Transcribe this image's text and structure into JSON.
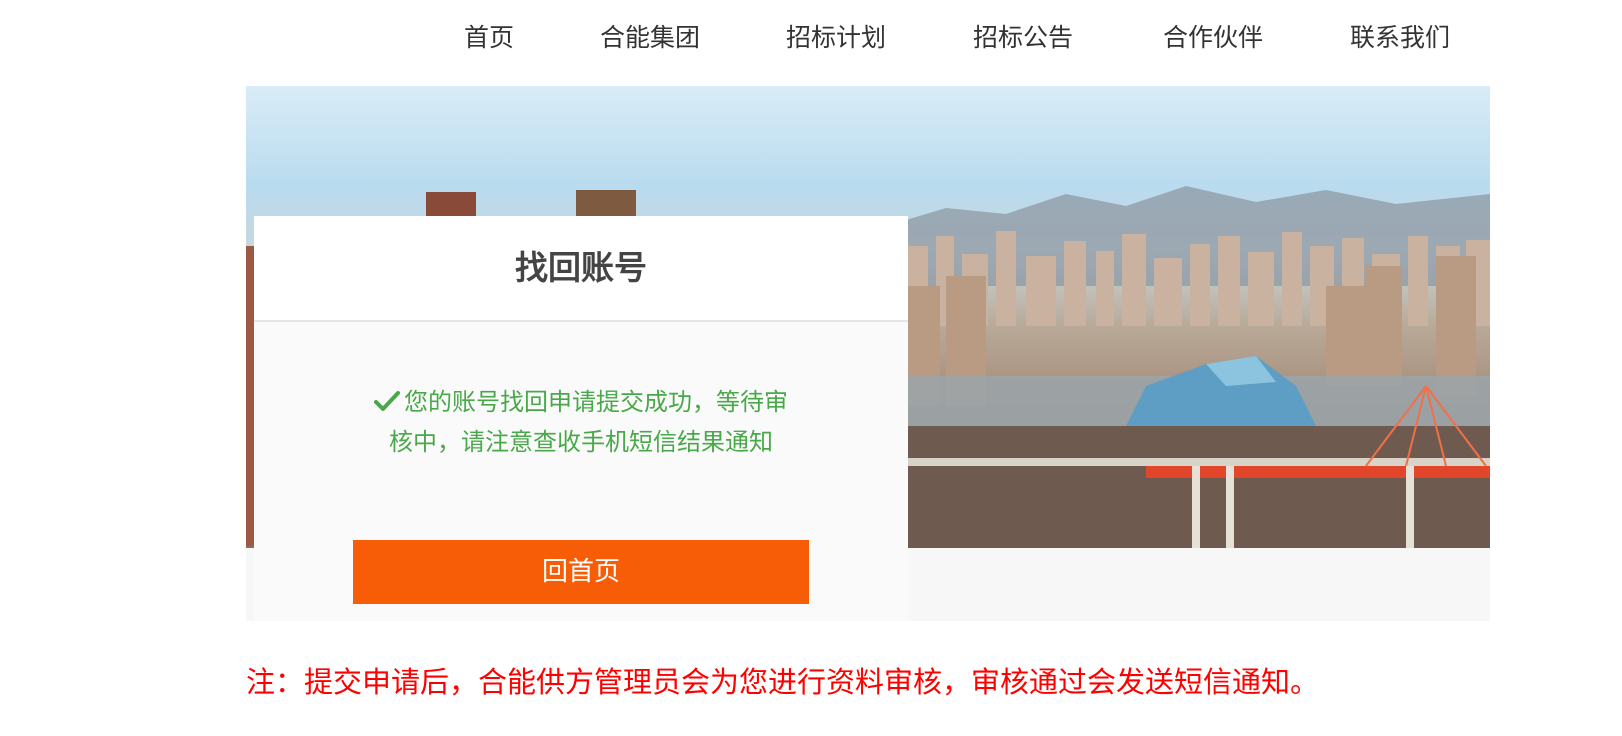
{
  "nav": {
    "items": [
      {
        "label": "首页"
      },
      {
        "label": "合能集团"
      },
      {
        "label": "招标计划"
      },
      {
        "label": "招标公告"
      },
      {
        "label": "合作伙伴"
      },
      {
        "label": "联系我们"
      }
    ]
  },
  "card": {
    "title": "找回账号",
    "status_icon": "check-icon",
    "message_line1": "您的账号找回申请提交成功，等待审",
    "message_line2": "核中，请注意查收手机短信结果通知",
    "home_button_label": "回首页"
  },
  "note": "注：提交申请后，合能供方管理员会为您进行资料审核，审核通过会发送短信通知。",
  "colors": {
    "accent": "#f75d06",
    "success": "#49a84a",
    "warning": "#ff0000"
  }
}
